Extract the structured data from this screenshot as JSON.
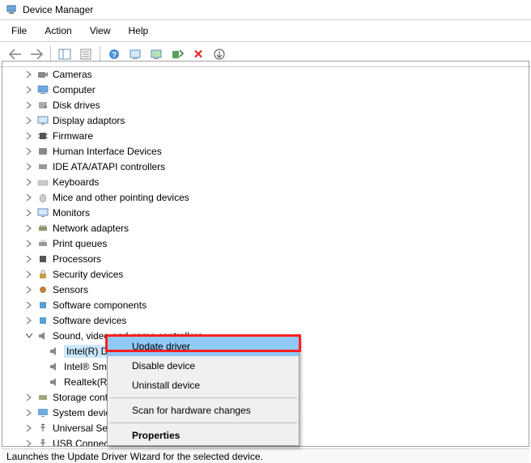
{
  "window": {
    "title": "Device Manager"
  },
  "menu": {
    "file": "File",
    "action": "Action",
    "view": "View",
    "help": "Help"
  },
  "tree": {
    "items": [
      {
        "label": "Cameras"
      },
      {
        "label": "Computer"
      },
      {
        "label": "Disk drives"
      },
      {
        "label": "Display adaptors"
      },
      {
        "label": "Firmware"
      },
      {
        "label": "Human Interface Devices"
      },
      {
        "label": "IDE ATA/ATAPI controllers"
      },
      {
        "label": "Keyboards"
      },
      {
        "label": "Mice and other pointing devices"
      },
      {
        "label": "Monitors"
      },
      {
        "label": "Network adapters"
      },
      {
        "label": "Print queues"
      },
      {
        "label": "Processors"
      },
      {
        "label": "Security devices"
      },
      {
        "label": "Sensors"
      },
      {
        "label": "Software components"
      },
      {
        "label": "Software devices"
      },
      {
        "label": "Sound, video and game controllers",
        "expanded": true,
        "children": [
          {
            "label": "Intel(R) Display Audio",
            "selected": true
          },
          {
            "label": "Intel® Sm"
          },
          {
            "label": "Realtek(R)"
          }
        ]
      },
      {
        "label": "Storage contr"
      },
      {
        "label": "System device"
      },
      {
        "label": "Universal Seri"
      },
      {
        "label": "USB Connecto"
      }
    ]
  },
  "context_menu": {
    "items": [
      {
        "label": "Update driver",
        "highlighted": true
      },
      {
        "label": "Disable device"
      },
      {
        "label": "Uninstall device"
      },
      {
        "sep": true
      },
      {
        "label": "Scan for hardware changes"
      },
      {
        "sep": true
      },
      {
        "label": "Properties",
        "bold": true
      }
    ]
  },
  "status": "Launches the Update Driver Wizard for the selected device.",
  "icons": {
    "back": "back-icon",
    "forward": "forward-icon",
    "details": "details-icon",
    "list": "list-icon",
    "help": "help-icon",
    "monitor": "monitor-icon",
    "devmon": "device-monitor-icon",
    "scan": "scan-icon",
    "delete": "delete-icon",
    "updown": "updown-icon"
  }
}
